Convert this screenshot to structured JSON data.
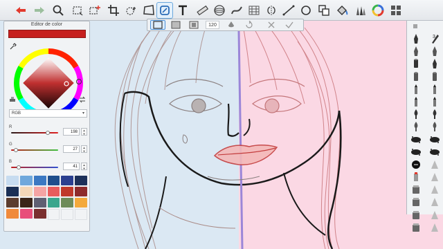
{
  "colors": {
    "accent_active": "#4a90d9",
    "current_color": "#c6201f"
  },
  "toolbar": {
    "tools": [
      {
        "name": "undo-icon"
      },
      {
        "name": "redo-icon"
      },
      {
        "name": "zoom-icon"
      },
      {
        "name": "rect-select-icon"
      },
      {
        "name": "select-plus-icon"
      },
      {
        "name": "crop-icon"
      },
      {
        "name": "move-icon"
      },
      {
        "name": "distort-icon"
      },
      {
        "name": "brush-tool-icon"
      },
      {
        "name": "text-icon"
      },
      {
        "name": "ruler-icon"
      },
      {
        "name": "ellipse-guide-icon"
      },
      {
        "name": "french-curve-icon"
      },
      {
        "name": "perspective-grid-icon"
      },
      {
        "name": "symmetry-icon"
      },
      {
        "name": "stroke-line-icon"
      },
      {
        "name": "circle-shape-icon"
      },
      {
        "name": "layers-copy-icon"
      },
      {
        "name": "fill-bucket-icon"
      },
      {
        "name": "brush-set-icon"
      },
      {
        "name": "color-wheel-icon"
      },
      {
        "name": "grid-menu-icon"
      }
    ]
  },
  "subbar": {
    "size_value": "120"
  },
  "color_editor": {
    "title": "Editor de color",
    "mode": "RGB",
    "channels": [
      {
        "label": "R",
        "value": "198",
        "fraction": 0.776
      },
      {
        "label": "G",
        "value": "27",
        "fraction": 0.106
      },
      {
        "label": "B",
        "value": "41",
        "fraction": 0.161
      }
    ],
    "swatches": [
      "#c7dcf0",
      "#6fa8dc",
      "#3b78c2",
      "#1f4e8c",
      "#2b3f8f",
      "#1d3059",
      "#1a2f55",
      "#f3d7b8",
      "#f4a4a4",
      "#e85d5d",
      "#c0392b",
      "#8e2b2b",
      "#5c3d2e",
      "#3a2418",
      "#5f5f72",
      "#3aa68d",
      "#6e8b5a",
      "#f4a93b",
      "#f08a3c",
      "#e84e7a",
      "#7a2f2f",
      "#f1f3f5",
      "#f1f3f5",
      "#f1f3f5"
    ]
  },
  "brush_panel": {
    "count": "3"
  }
}
